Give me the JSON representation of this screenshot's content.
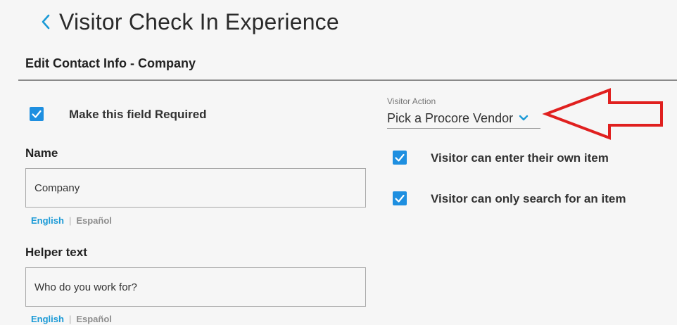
{
  "header": {
    "title": "Visitor Check In Experience"
  },
  "section": {
    "title": "Edit Contact Info - Company"
  },
  "required": {
    "label": "Make this field Required",
    "checked": true
  },
  "name_field": {
    "label": "Name",
    "value": "Company",
    "languages": [
      "English",
      "Español"
    ],
    "active_language": "English"
  },
  "helper_field": {
    "label": "Helper text",
    "value": "Who do you work for?",
    "languages": [
      "English",
      "Español"
    ],
    "active_language": "English"
  },
  "visitor_action": {
    "label": "Visitor Action",
    "selected": "Pick a Procore Vendor"
  },
  "options": [
    {
      "label": "Visitor can enter their own item",
      "checked": true
    },
    {
      "label": "Visitor can only search for an item",
      "checked": true
    }
  ],
  "colors": {
    "accent": "#1e8fe0",
    "link": "#1b9ad6",
    "annotation_arrow": "#e0201f"
  }
}
